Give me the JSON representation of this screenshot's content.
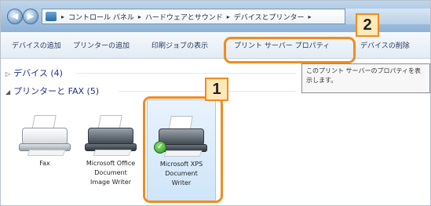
{
  "address_bar": {
    "crumbs": [
      "コントロール パネル",
      "ハードウェアとサウンド",
      "デバイスとプリンター"
    ]
  },
  "nav": {
    "back_icon": "back-arrow-icon",
    "forward_icon": "forward-arrow-icon"
  },
  "toolbar": {
    "add_device": "デバイスの追加",
    "add_printer": "プリンターの追加",
    "print_jobs": "印刷ジョブの表示",
    "print_server_properties": "プリント サーバー プロパティ",
    "remove_device": "デバイスの削除"
  },
  "tooltip": {
    "text": "このプリント サーバーのプロパティを表示します。"
  },
  "groups": {
    "devices": "デバイス (4)",
    "printers": "プリンターと FAX (5)"
  },
  "devices": [
    {
      "label": "Fax",
      "icon": "fax-icon"
    },
    {
      "label": "Microsoft Office\nDocument\nImage Writer",
      "icon": "printer-icon"
    },
    {
      "label": "Microsoft XPS\nDocument\nWriter",
      "icon": "printer-icon",
      "default": true
    }
  ],
  "callouts": {
    "one": "1",
    "two": "2"
  },
  "colors": {
    "callout": "#f08c1e",
    "callout_fill": "#fde8b8",
    "selection": "#cfe5fa"
  }
}
